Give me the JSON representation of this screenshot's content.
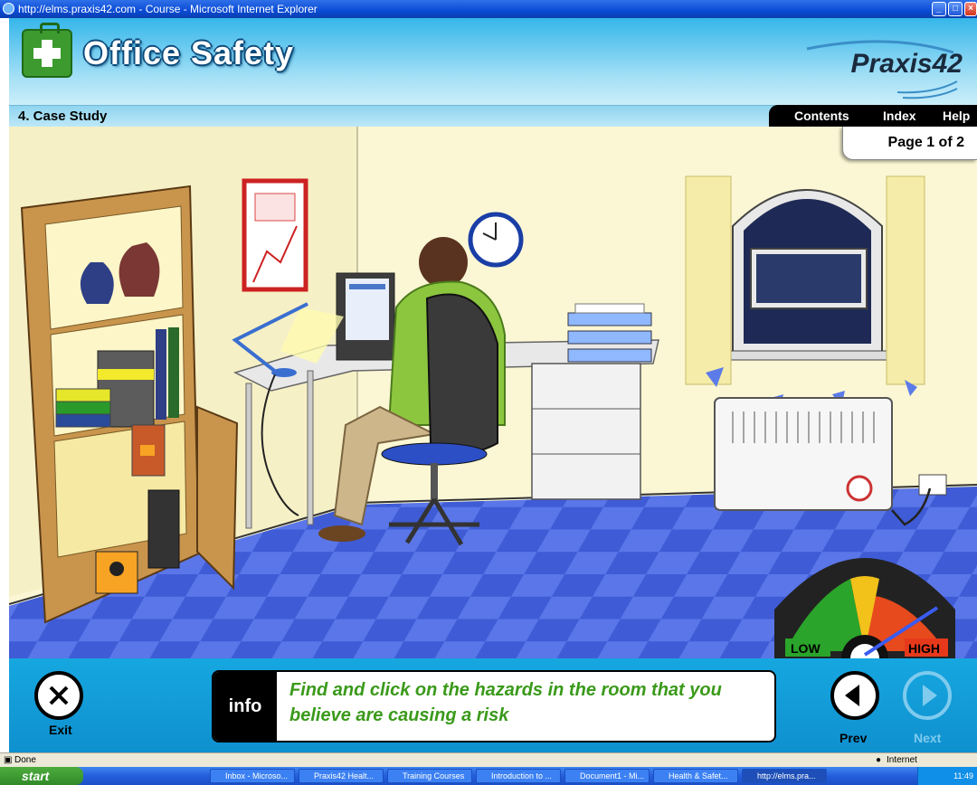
{
  "browser": {
    "title": "http://elms.praxis42.com - Course - Microsoft Internet Explorer",
    "status_left": "Done",
    "status_right": "Internet"
  },
  "header": {
    "app_title": "Office Safety",
    "brand": "Praxis42",
    "section_title": "4. Case Study",
    "nav": [
      "Contents",
      "Index",
      "Help"
    ],
    "page_indicator": "Page 1 of 2"
  },
  "risk_gauge": {
    "low_label": "LOW",
    "high_label": "HIGH"
  },
  "footer": {
    "exit_label": "Exit",
    "info_tag": "info",
    "info_message": "Find and click on the hazards in the room that you believe are causing a risk",
    "prev_label": "Prev",
    "next_label": "Next"
  },
  "taskbar": {
    "start_label": "start",
    "items": [
      "Inbox - Microso...",
      "Praxis42 Healt...",
      "Training Courses",
      "Introduction to ...",
      "Document1 - Mi...",
      "Health & Safet...",
      "http://elms.pra..."
    ],
    "clock": "11:49"
  },
  "colors": {
    "header_blue": "#35b6ea",
    "footer_blue": "#16a7e0",
    "info_text_green": "#3a9a1a",
    "floor_blue": "#4a66e0"
  }
}
